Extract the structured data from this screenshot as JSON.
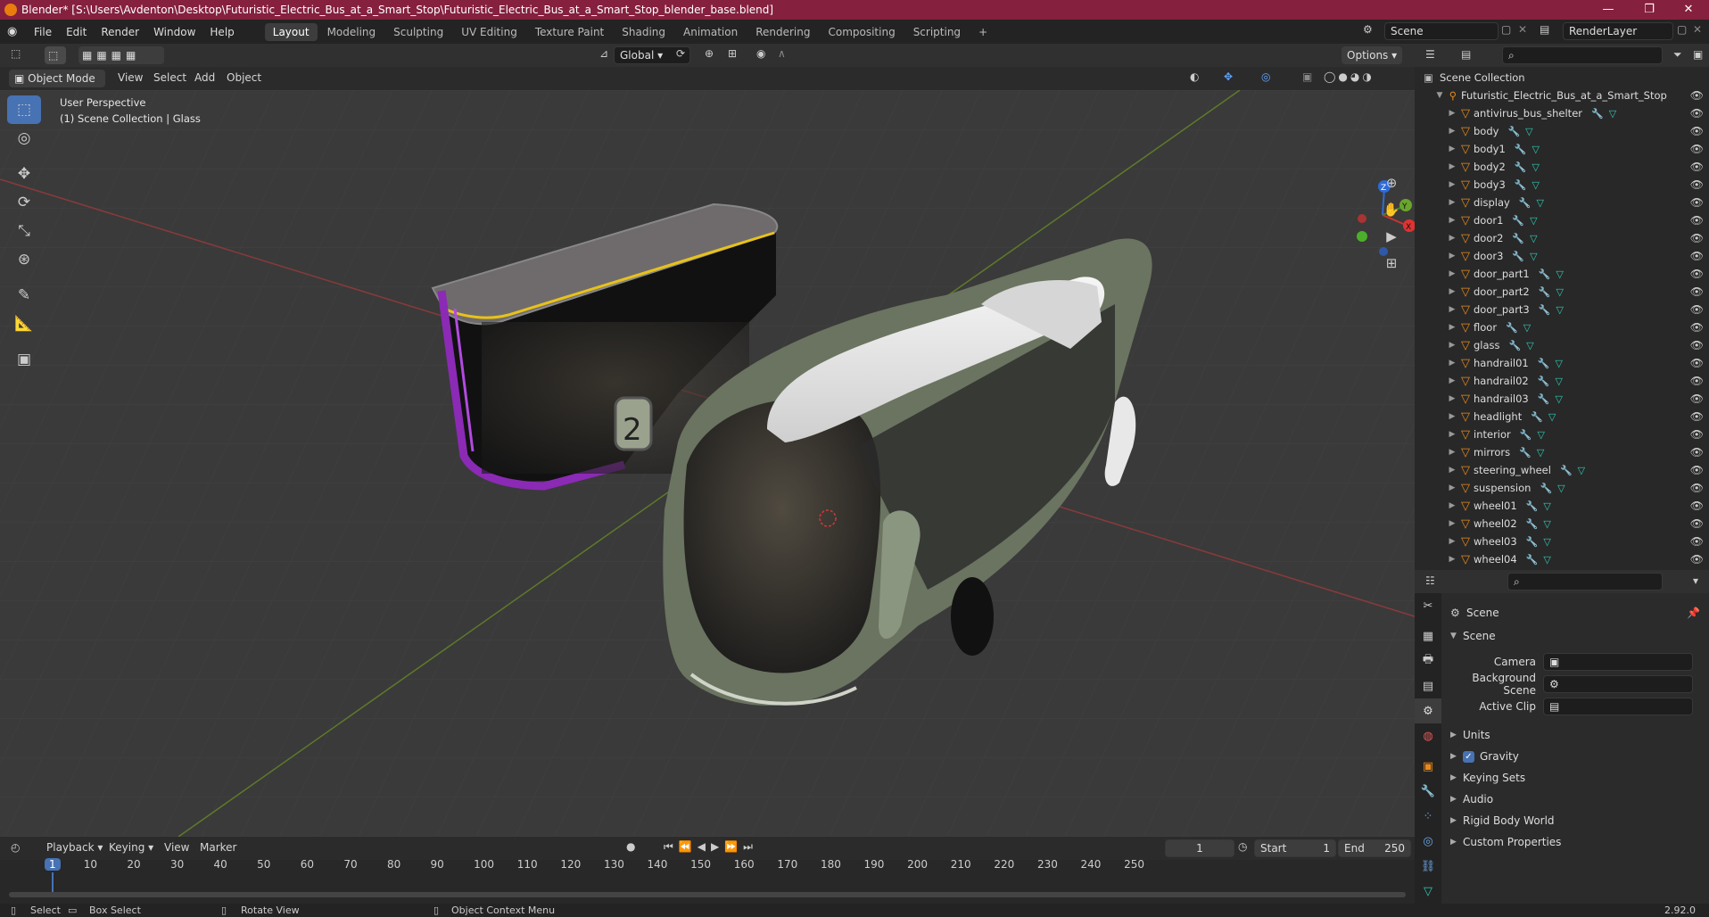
{
  "window": {
    "title": "Blender* [S:\\Users\\Avdenton\\Desktop\\Futuristic_Electric_Bus_at_a_Smart_Stop\\Futuristic_Electric_Bus_at_a_Smart_Stop_blender_base.blend]",
    "minimize": "—",
    "maximize": "❐",
    "close": "✕"
  },
  "menu": [
    "File",
    "Edit",
    "Render",
    "Window",
    "Help"
  ],
  "workspaces": [
    {
      "label": "Layout",
      "active": true
    },
    {
      "label": "Modeling"
    },
    {
      "label": "Sculpting"
    },
    {
      "label": "UV Editing"
    },
    {
      "label": "Texture Paint"
    },
    {
      "label": "Shading"
    },
    {
      "label": "Animation"
    },
    {
      "label": "Rendering"
    },
    {
      "label": "Compositing"
    },
    {
      "label": "Scripting"
    }
  ],
  "add_workspace": "+",
  "scene_field": "Scene",
  "render_layer_field": "RenderLayer",
  "toolbar": {
    "orientation": "Global",
    "options": "Options"
  },
  "viewport_header": {
    "mode": "Object Mode",
    "menus": [
      "View",
      "Select",
      "Add",
      "Object"
    ]
  },
  "viewport": {
    "line1": "User Perspective",
    "line2": "(1) Scene Collection | Glass",
    "shelter_number": "2",
    "gizmo": {
      "z": "Z",
      "y": "Y",
      "x": "X"
    }
  },
  "outliner": {
    "root": "Scene Collection",
    "collection": "Futuristic_Electric_Bus_at_a_Smart_Stop",
    "items": [
      "antivirus_bus_shelter",
      "body",
      "body1",
      "body2",
      "body3",
      "display",
      "door1",
      "door2",
      "door3",
      "door_part1",
      "door_part2",
      "door_part3",
      "floor",
      "glass",
      "handrail01",
      "handrail02",
      "handrail03",
      "headlight",
      "interior",
      "mirrors",
      "steering_wheel",
      "suspension",
      "wheel01",
      "wheel02",
      "wheel03",
      "wheel04"
    ]
  },
  "properties": {
    "context": "Scene",
    "panel": "Scene",
    "camera_label": "Camera",
    "background_label": "Background Scene",
    "clip_label": "Active Clip",
    "sections": [
      "Units",
      "Gravity",
      "Keying Sets",
      "Audio",
      "Rigid Body World",
      "Custom Properties"
    ],
    "gravity_checked": true
  },
  "timeline": {
    "menus": [
      "Playback",
      "Keying",
      "View",
      "Marker"
    ],
    "current_frame": "1",
    "start_label": "Start",
    "start": "1",
    "end_label": "End",
    "end": "250",
    "ticks": [
      "1",
      "10",
      "20",
      "30",
      "40",
      "50",
      "60",
      "70",
      "80",
      "90",
      "100",
      "110",
      "120",
      "130",
      "140",
      "150",
      "160",
      "170",
      "180",
      "190",
      "200",
      "210",
      "220",
      "230",
      "240",
      "250"
    ]
  },
  "statusbar": {
    "select": "Select",
    "box_select": "Box Select",
    "rotate": "Rotate View",
    "context_menu": "Object Context Menu",
    "version": "2.92.0"
  }
}
